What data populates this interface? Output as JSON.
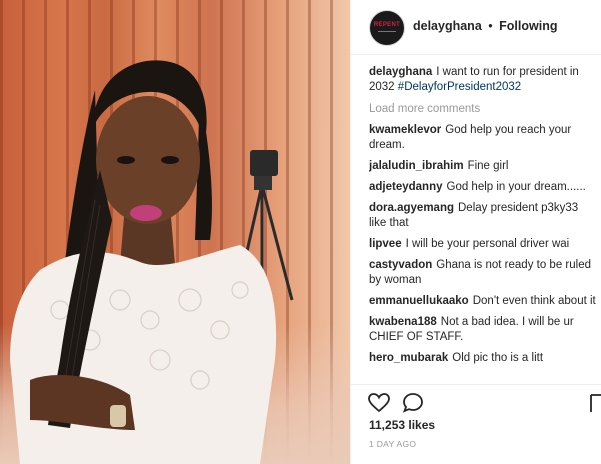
{
  "header": {
    "username": "delayghana",
    "separator": "•",
    "follow_status": "Following",
    "avatar_text": "REPENT"
  },
  "caption": {
    "username": "delayghana",
    "text": "I want to run for president in 2032",
    "hashtag": "#DelayforPresident2032"
  },
  "load_more": "Load more comments",
  "comments": [
    {
      "user": "kwameklevor",
      "text": "God help you reach your dream."
    },
    {
      "user": "jalaludin_ibrahim",
      "text": "Fine girl"
    },
    {
      "user": "adjeteydanny",
      "text": "God help in your dream......"
    },
    {
      "user": "dora.agyemang",
      "text": "Delay president p3ky33 like that"
    },
    {
      "user": "lipvee",
      "text": "I will be your personal driver wai"
    },
    {
      "user": "castyvadon",
      "text": "Ghana is not ready to be ruled by woman"
    },
    {
      "user": "emmanuellukaako",
      "text": "Don't even think about it"
    },
    {
      "user": "kwabena188",
      "text": "Not a bad idea. I will be ur CHIEF OF STAFF."
    },
    {
      "user": "hero_mubarak",
      "text": "Old pic tho is a litt"
    }
  ],
  "likes": "11,253 likes",
  "timestamp": "1 DAY AGO",
  "icons": [
    "heart-icon",
    "comment-icon",
    "bookmark-icon"
  ],
  "colors": {
    "hashtag": "#003569",
    "muted": "#999999",
    "text": "#262626",
    "divider": "#efefef"
  }
}
